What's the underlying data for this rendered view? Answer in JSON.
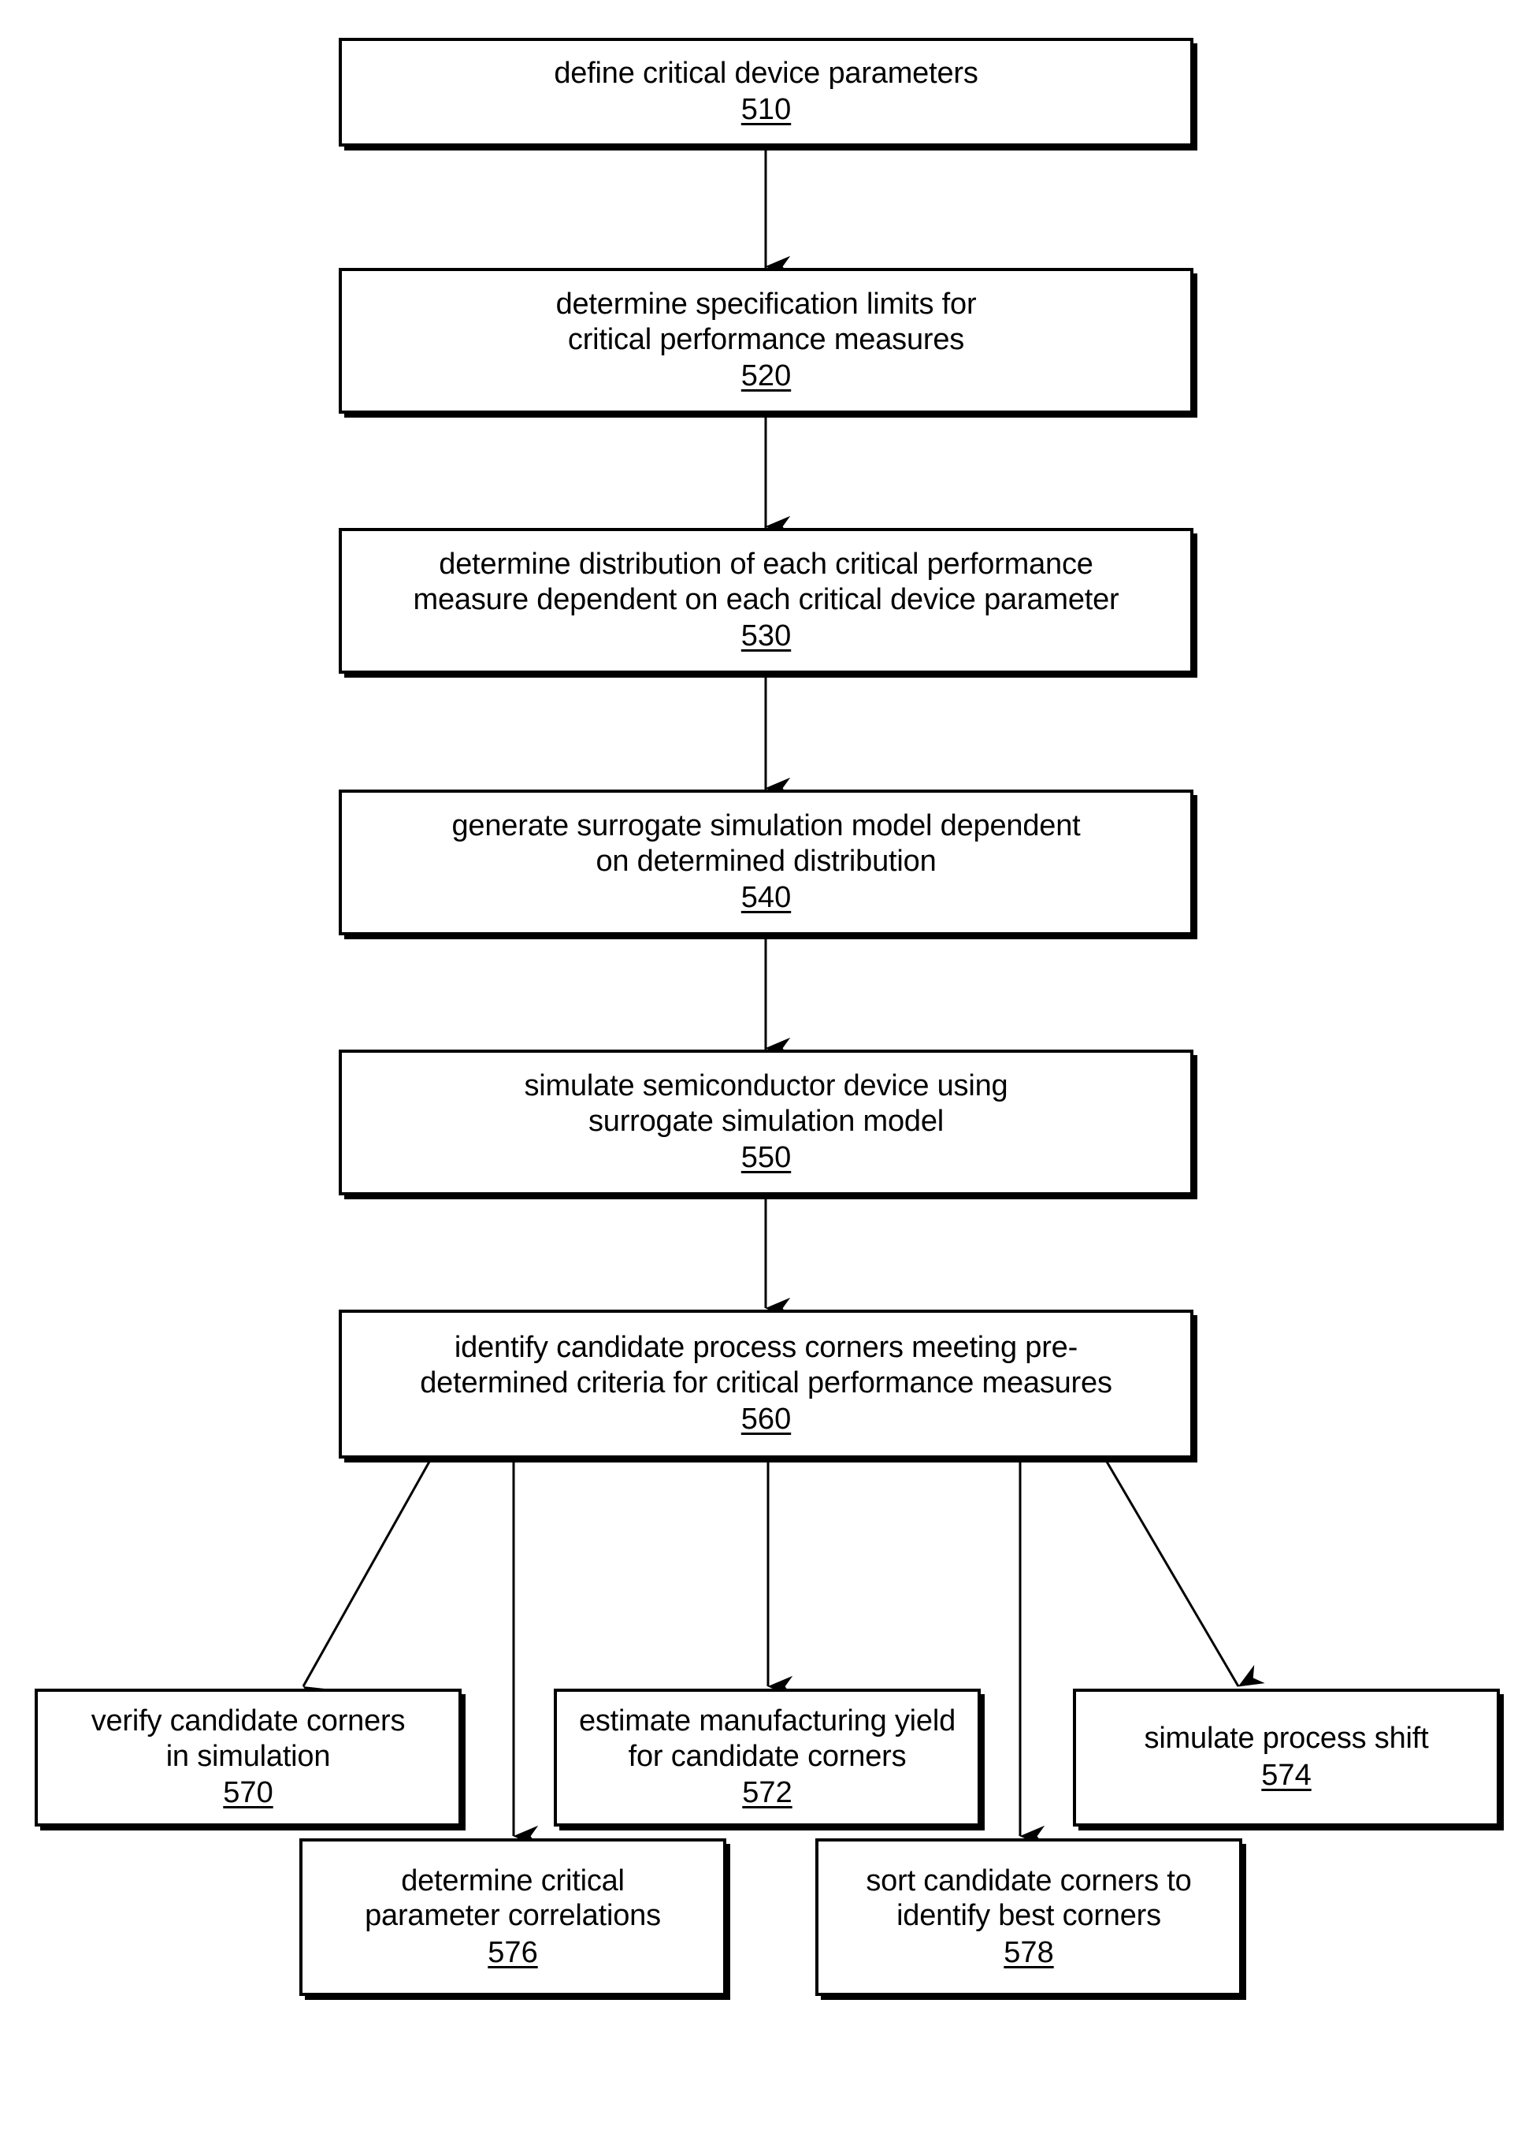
{
  "figure": {
    "type": "process-flowchart",
    "title": "",
    "orientation": "top-to-bottom",
    "line_color": "#000000",
    "fill_color": "#ffffff"
  },
  "nodes": [
    {
      "id": "n510",
      "ref": "510",
      "text": "define critical device parameters"
    },
    {
      "id": "n520",
      "ref": "520",
      "text": "determine specification limits for\ncritical performance measures"
    },
    {
      "id": "n530",
      "ref": "530",
      "text": "determine distribution of each critical performance\nmeasure dependent on each critical device parameter"
    },
    {
      "id": "n540",
      "ref": "540",
      "text": "generate surrogate simulation model dependent\non determined distribution"
    },
    {
      "id": "n550",
      "ref": "550",
      "text": "simulate semiconductor device using\nsurrogate simulation model"
    },
    {
      "id": "n560",
      "ref": "560",
      "text": "identify candidate process corners meeting pre-\ndetermined criteria for critical performance measures"
    },
    {
      "id": "n570",
      "ref": "570",
      "text": "verify candidate corners\nin simulation"
    },
    {
      "id": "n572",
      "ref": "572",
      "text": "estimate manufacturing yield\nfor candidate corners"
    },
    {
      "id": "n574",
      "ref": "574",
      "text": "simulate process shift"
    },
    {
      "id": "n576",
      "ref": "576",
      "text": "determine critical\nparameter correlations"
    },
    {
      "id": "n578",
      "ref": "578",
      "text": "sort candidate corners to\nidentify best corners"
    }
  ],
  "edges": [
    {
      "from": "n510",
      "to": "n520",
      "style": "straight-arrow"
    },
    {
      "from": "n520",
      "to": "n530",
      "style": "straight-arrow"
    },
    {
      "from": "n530",
      "to": "n540",
      "style": "straight-arrow"
    },
    {
      "from": "n540",
      "to": "n550",
      "style": "straight-arrow"
    },
    {
      "from": "n550",
      "to": "n560",
      "style": "straight-arrow"
    },
    {
      "from": "n560",
      "to": "n570",
      "style": "diagonal-arrow"
    },
    {
      "from": "n560",
      "to": "n572",
      "style": "straight-arrow"
    },
    {
      "from": "n560",
      "to": "n574",
      "style": "diagonal-arrow"
    },
    {
      "from": "n560",
      "to": "n576",
      "style": "straight-arrow"
    },
    {
      "from": "n560",
      "to": "n578",
      "style": "straight-arrow"
    }
  ]
}
